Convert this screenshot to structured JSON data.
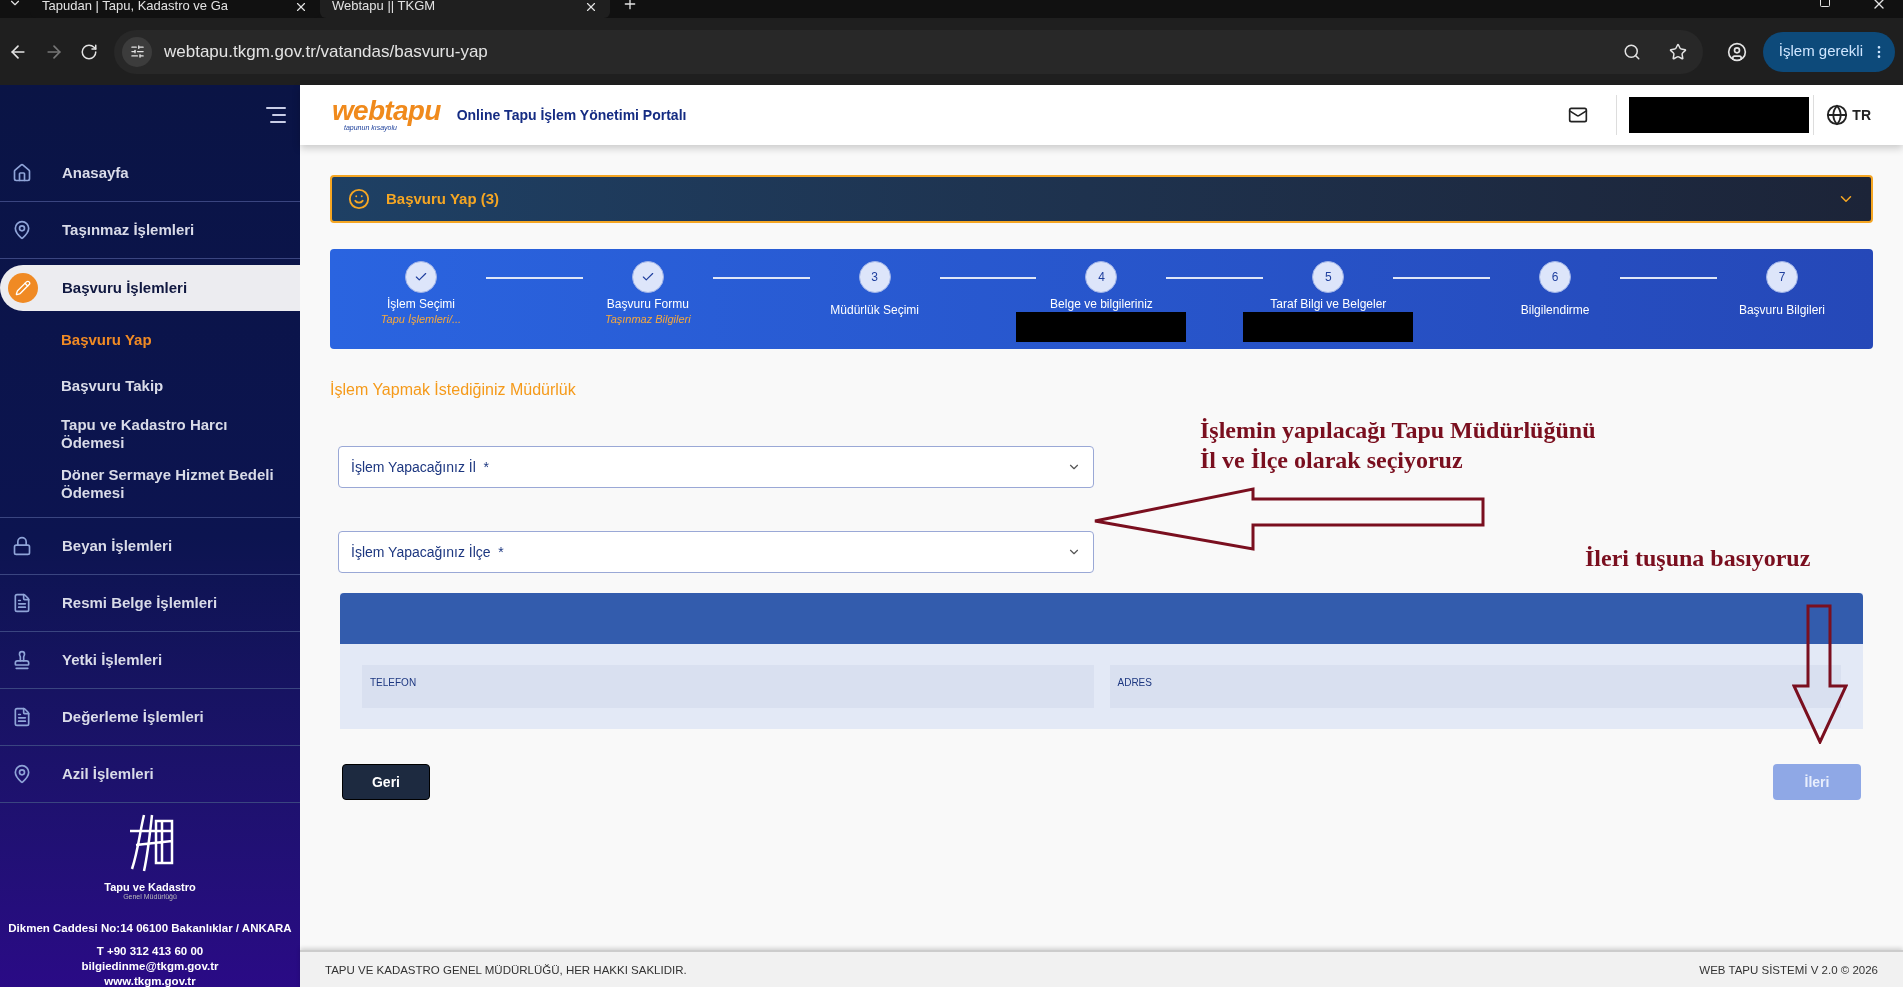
{
  "browser": {
    "tabs": [
      {
        "title": "Tapudan | Tapu, Kadastro ve Ga",
        "selected": false
      },
      {
        "title": "Webtapu || TKGM",
        "selected": true
      }
    ],
    "url": "webtapu.tkgm.gov.tr/vatandas/basvuru-yap",
    "profile_button": "İşlem gerekli"
  },
  "sidebar": {
    "items": [
      {
        "label": "Anasayfa",
        "selected": false
      },
      {
        "label": "Taşınmaz İşlemleri",
        "selected": false
      },
      {
        "label": "Başvuru İşlemleri",
        "selected": true,
        "expanded": true,
        "children": [
          {
            "label": "Başvuru Yap",
            "selected": true
          },
          {
            "label": "Başvuru Takip",
            "selected": false
          },
          {
            "label": "Tapu ve Kadastro Harcı Ödemesi",
            "selected": false
          },
          {
            "label": "Döner Sermaye Hizmet Bedeli Ödemesi",
            "selected": false
          }
        ]
      },
      {
        "label": "Beyan İşlemleri",
        "selected": false
      },
      {
        "label": "Resmi Belge İşlemleri",
        "selected": false
      },
      {
        "label": "Yetki İşlemleri",
        "selected": false
      },
      {
        "label": "Değerleme İşlemleri",
        "selected": false
      },
      {
        "label": "Azil İşlemleri",
        "selected": false
      }
    ],
    "logo": {
      "name": "Tapu ve Kadastro",
      "subtitle": "Genel Müdürlüğü"
    },
    "contact": [
      "Dikmen Caddesi No:14 06100 Bakanlıklar / ANKARA",
      "T +90 312 413 60 00",
      "bilgiedinme@tkgm.gov.tr",
      "www.tkgm.gov.tr"
    ]
  },
  "header": {
    "logo": {
      "name": "webtapu",
      "tagline": "tapunun kısayolu"
    },
    "portal_title": "Online Tapu İşlem Yönetimi Portalı",
    "language": "TR"
  },
  "accordion": {
    "title": "Başvuru Yap (3)",
    "expanded": false
  },
  "stepper": {
    "steps": [
      {
        "label": "İşlem Seçimi",
        "sublabel": "Tapu İşlemleri/...",
        "completed": true,
        "redacted": false
      },
      {
        "label": "Başvuru Formu",
        "sublabel": "Taşınmaz Bilgileri",
        "completed": true,
        "redacted": false
      },
      {
        "number": "3",
        "label": "Müdürlük Seçimi",
        "completed": false,
        "redacted": false
      },
      {
        "number": "4",
        "label": "Belge ve bilgileriniz",
        "completed": false,
        "redacted": true
      },
      {
        "number": "5",
        "label": "Taraf Bilgi ve Belgeler",
        "completed": false,
        "redacted": true
      },
      {
        "number": "6",
        "label": "Bilgilendirme",
        "completed": false,
        "redacted": false
      },
      {
        "number": "7",
        "label": "Başvuru Bilgileri",
        "completed": false,
        "redacted": false
      }
    ]
  },
  "form": {
    "section_title": "İşlem Yapmak İstediğiniz Müdürlük",
    "selects": [
      {
        "placeholder": "İşlem Yapacağınız İl  *"
      },
      {
        "placeholder": "İşlem Yapacağınız İlçe  *"
      }
    ],
    "office_card": {
      "fields": [
        "TELEFON",
        "ADRES"
      ]
    },
    "back_button": "Geri",
    "next_button": {
      "label": "İleri",
      "disabled": true
    }
  },
  "annotations": [
    {
      "lines": [
        "İşlemin yapılacağı Tapu Müdürlüğünü",
        "İl ve İlçe olarak seçiyoruz"
      ]
    },
    {
      "lines": [
        "İleri tuşuna basıyoruz"
      ]
    }
  ],
  "footer": {
    "left": "TAPU VE KADASTRO GENEL MÜDÜRLÜĞÜ, HER HAKKI SAKLIDIR.",
    "right": "WEB TAPU SİSTEMİ V 2.0 © 2026"
  }
}
